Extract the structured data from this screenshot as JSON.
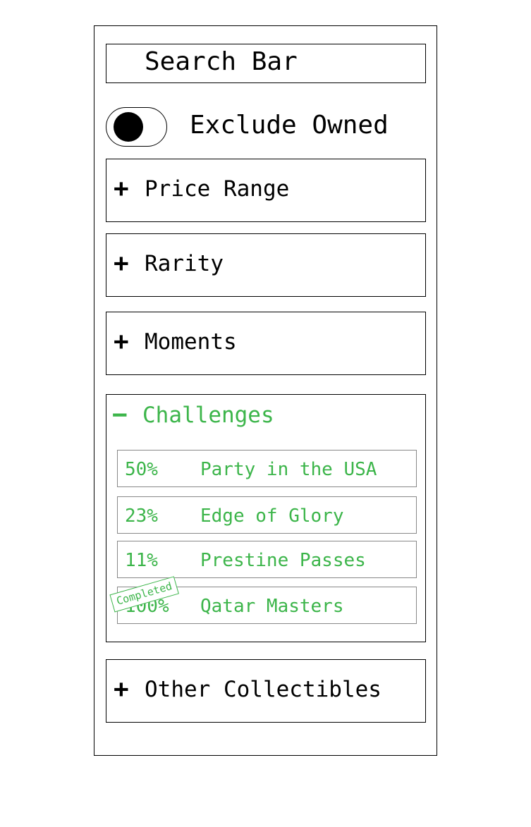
{
  "search": {
    "label": "Search Bar"
  },
  "toggle": {
    "label": "Exclude Owned"
  },
  "sections": {
    "price_range": {
      "icon": "+",
      "label": "Price Range"
    },
    "rarity": {
      "icon": "+",
      "label": "Rarity"
    },
    "moments": {
      "icon": "+",
      "label": "Moments"
    },
    "challenges": {
      "icon": "−",
      "label": "Challenges",
      "items": [
        {
          "progress": "50%",
          "name": "Party in the USA"
        },
        {
          "progress": "23%",
          "name": "Edge of Glory"
        },
        {
          "progress": "11%",
          "name": "Prestine Passes"
        },
        {
          "progress": "100%",
          "name": "Qatar Masters",
          "badge": "Completed"
        }
      ]
    },
    "other_collectibles": {
      "icon": "+",
      "label": "Other Collectibles"
    }
  },
  "colors": {
    "accent": "#3cb54a",
    "border": "#000000",
    "row_border": "#888888"
  }
}
